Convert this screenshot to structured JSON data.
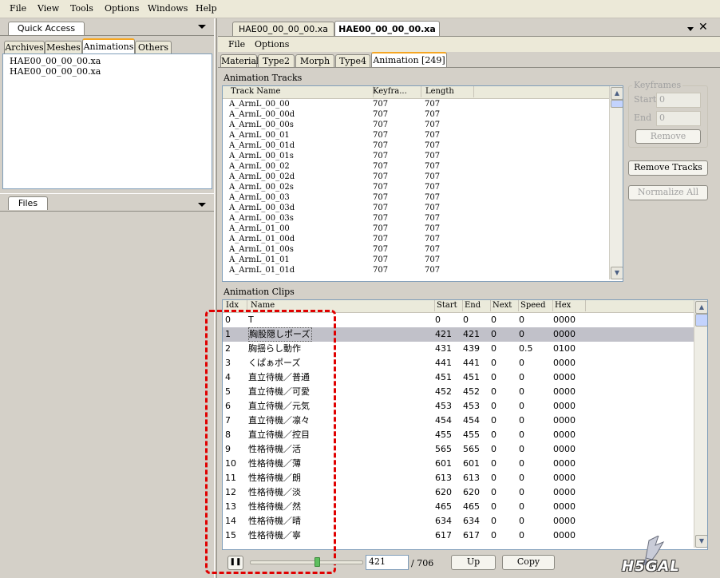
{
  "menu": [
    "File",
    "View",
    "Tools",
    "Options",
    "Windows",
    "Help"
  ],
  "quick_access": {
    "title": "Quick Access",
    "tabs": [
      "Archives",
      "Meshes",
      "Animations",
      "Others"
    ],
    "active_tab": "Animations",
    "items": [
      "HAE00_00_00_00.xa",
      "HAE00_00_00_00.xa"
    ]
  },
  "files_panel": {
    "title": "Files"
  },
  "doc_tabs": [
    "HAE00_00_00_00.xa",
    "HAE00_00_00_00.xa"
  ],
  "doc_menu": [
    "File",
    "Options"
  ],
  "editor_tabs": [
    "Material",
    "Type2",
    "Morph",
    "Type4",
    "Animation [249]"
  ],
  "animation_tracks": {
    "label": "Animation Tracks",
    "columns": [
      "Track Name",
      "Keyfra...",
      "Length"
    ],
    "rows": [
      [
        "A_ArmL_00_00",
        "707",
        "707"
      ],
      [
        "A_ArmL_00_00d",
        "707",
        "707"
      ],
      [
        "A_ArmL_00_00s",
        "707",
        "707"
      ],
      [
        "A_ArmL_00_01",
        "707",
        "707"
      ],
      [
        "A_ArmL_00_01d",
        "707",
        "707"
      ],
      [
        "A_ArmL_00_01s",
        "707",
        "707"
      ],
      [
        "A_ArmL_00_02",
        "707",
        "707"
      ],
      [
        "A_ArmL_00_02d",
        "707",
        "707"
      ],
      [
        "A_ArmL_00_02s",
        "707",
        "707"
      ],
      [
        "A_ArmL_00_03",
        "707",
        "707"
      ],
      [
        "A_ArmL_00_03d",
        "707",
        "707"
      ],
      [
        "A_ArmL_00_03s",
        "707",
        "707"
      ],
      [
        "A_ArmL_01_00",
        "707",
        "707"
      ],
      [
        "A_ArmL_01_00d",
        "707",
        "707"
      ],
      [
        "A_ArmL_01_00s",
        "707",
        "707"
      ],
      [
        "A_ArmL_01_01",
        "707",
        "707"
      ],
      [
        "A_ArmL_01_01d",
        "707",
        "707"
      ]
    ]
  },
  "keyframes": {
    "label": "Keyframes",
    "start_label": "Start",
    "start_value": "0",
    "end_label": "End",
    "end_value": "0",
    "remove_label": "Remove"
  },
  "remove_tracks_label": "Remove Tracks",
  "normalize_all_label": "Normalize All",
  "animation_clips": {
    "label": "Animation Clips",
    "columns": [
      "Idx",
      "Name",
      "Start",
      "End",
      "Next",
      "Speed",
      "Hex"
    ],
    "selected_index": 1,
    "rows": [
      [
        "0",
        "T",
        "0",
        "0",
        "0",
        "0",
        "0000"
      ],
      [
        "1",
        "胸股隠しポーズ",
        "421",
        "421",
        "0",
        "0",
        "0000"
      ],
      [
        "2",
        "胸揺らし動作",
        "431",
        "439",
        "0",
        "0.5",
        "0100"
      ],
      [
        "3",
        "くぱぁポーズ",
        "441",
        "441",
        "0",
        "0",
        "0000"
      ],
      [
        "4",
        "直立待機／普通",
        "451",
        "451",
        "0",
        "0",
        "0000"
      ],
      [
        "5",
        "直立待機／可愛",
        "452",
        "452",
        "0",
        "0",
        "0000"
      ],
      [
        "6",
        "直立待機／元気",
        "453",
        "453",
        "0",
        "0",
        "0000"
      ],
      [
        "7",
        "直立待機／凛々",
        "454",
        "454",
        "0",
        "0",
        "0000"
      ],
      [
        "8",
        "直立待機／控目",
        "455",
        "455",
        "0",
        "0",
        "0000"
      ],
      [
        "9",
        "性格待機／活",
        "565",
        "565",
        "0",
        "0",
        "0000"
      ],
      [
        "10",
        "性格待機／薄",
        "601",
        "601",
        "0",
        "0",
        "0000"
      ],
      [
        "11",
        "性格待機／朗",
        "613",
        "613",
        "0",
        "0",
        "0000"
      ],
      [
        "12",
        "性格待機／淡",
        "620",
        "620",
        "0",
        "0",
        "0000"
      ],
      [
        "13",
        "性格待機／然",
        "465",
        "465",
        "0",
        "0",
        "0000"
      ],
      [
        "14",
        "性格待機／晴",
        "634",
        "634",
        "0",
        "0",
        "0000"
      ],
      [
        "15",
        "性格待機／寧",
        "617",
        "617",
        "0",
        "0",
        "0000"
      ]
    ]
  },
  "playback": {
    "frame_value": "421",
    "frame_total": "/ 706",
    "slider_fraction": 0.6,
    "up_label": "Up",
    "copy_label": "Copy"
  },
  "watermark": "H5GAL",
  "colors": {
    "selection": "#c1c1c9",
    "highlight_border": "#e00000",
    "active_tab_line": "#f5a623"
  }
}
